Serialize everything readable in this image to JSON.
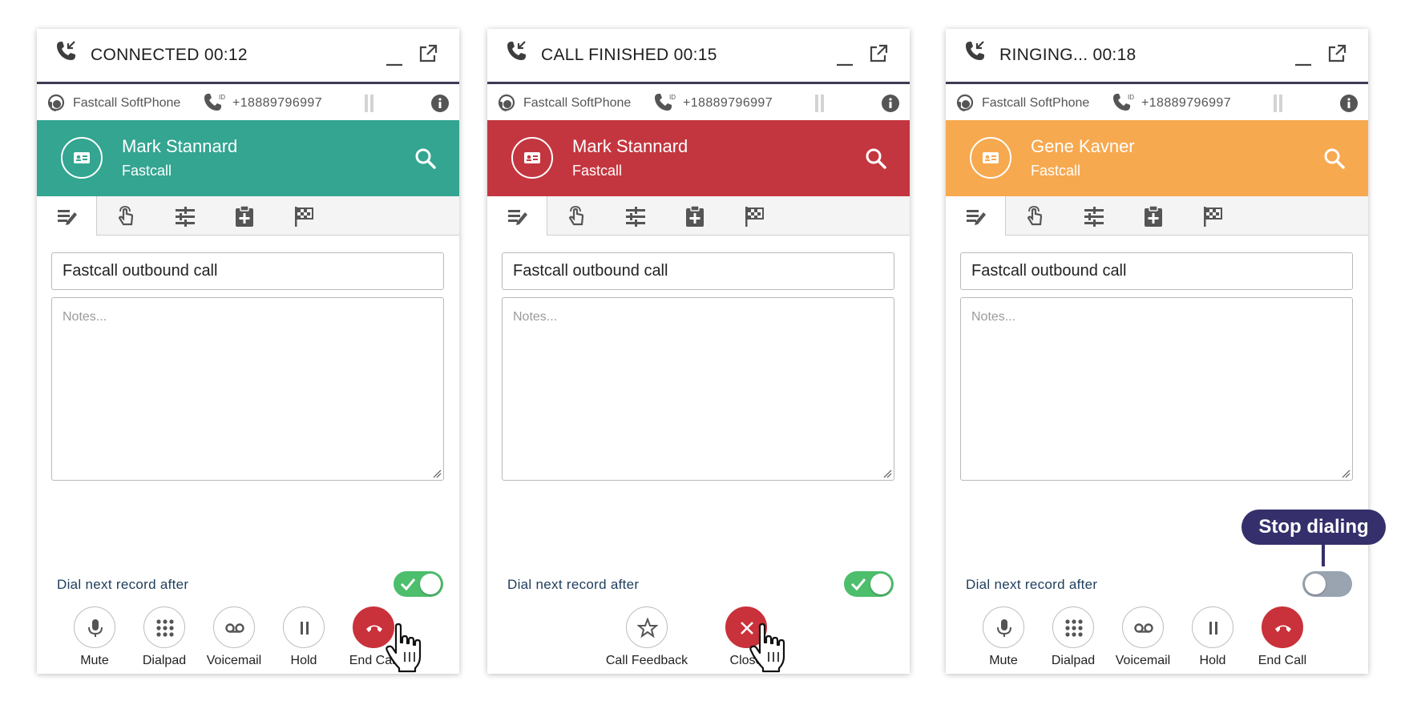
{
  "panels": [
    {
      "header": {
        "title": "CONNECTED 00:12"
      },
      "info": {
        "app_name": "Fastcall SoftPhone",
        "caller_id": "+18889796997"
      },
      "contact": {
        "name": "Mark Stannard",
        "company": "Fastcall",
        "color": "#33a591"
      },
      "subject": "Fastcall outbound call",
      "notes_placeholder": "Notes...",
      "dial_next_label": "Dial next record after",
      "dial_next_enabled": true,
      "actions": [
        "Mute",
        "Dialpad",
        "Voicemail",
        "Hold",
        "End Call"
      ]
    },
    {
      "header": {
        "title": "CALL FINISHED 00:15"
      },
      "info": {
        "app_name": "Fastcall SoftPhone",
        "caller_id": "+18889796997"
      },
      "contact": {
        "name": "Mark Stannard",
        "company": "Fastcall",
        "color": "#c4363f"
      },
      "subject": "Fastcall outbound call",
      "notes_placeholder": "Notes...",
      "dial_next_label": "Dial next record after",
      "dial_next_enabled": true,
      "actions": [
        "Call Feedback",
        "Close"
      ]
    },
    {
      "header": {
        "title": "RINGING... 00:18"
      },
      "info": {
        "app_name": "Fastcall SoftPhone",
        "caller_id": "+18889796997"
      },
      "contact": {
        "name": "Gene Kavner",
        "company": "Fastcall",
        "color": "#f7a94f"
      },
      "subject": "Fastcall outbound call",
      "notes_placeholder": "Notes...",
      "dial_next_label": "Dial next record after",
      "dial_next_enabled": false,
      "actions": [
        "Mute",
        "Dialpad",
        "Voicemail",
        "Hold",
        "End Call"
      ]
    }
  ],
  "tooltip": {
    "text": "Stop dialing",
    "color": "#35306b"
  },
  "icons": {
    "header": [
      "incoming-call-icon",
      "minimize-icon",
      "popout-icon"
    ],
    "info": [
      "agent-headset-icon",
      "caller-id-phone-icon",
      "drag-grip-icon",
      "info-icon"
    ],
    "tabs": [
      "notes-tab-icon",
      "touch-tab-icon",
      "settings-tab-icon",
      "clipboard-tab-icon",
      "flag-tab-icon"
    ],
    "cursor": "hand-pointer-icon"
  }
}
